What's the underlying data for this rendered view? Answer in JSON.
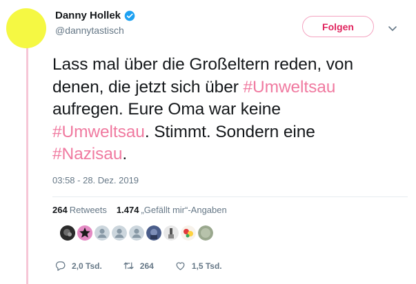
{
  "author": {
    "name": "Danny Hollek",
    "handle": "@dannytastisch"
  },
  "follow_label": "Folgen",
  "tweet": {
    "lines": [
      [
        {
          "t": "Lass mal über die Großeltern reden, von",
          "h": false
        }
      ],
      [
        {
          "t": "denen, die jetzt sich über ",
          "h": false
        },
        {
          "t": "#Umweltsau",
          "h": true
        }
      ],
      [
        {
          "t": "aufregen. Eure Oma war keine",
          "h": false
        }
      ],
      [
        {
          "t": "#Umweltsau",
          "h": true
        },
        {
          "t": ". Stimmt. Sondern eine",
          "h": false
        }
      ],
      [
        {
          "t": "#Nazisau",
          "h": true
        },
        {
          "t": ".",
          "h": false
        }
      ]
    ]
  },
  "timestamp": "03:58 - 28. Dez. 2019",
  "stats": {
    "retweets_count": "264",
    "retweets_label": "Retweets",
    "likes_count": "1.474",
    "likes_label": "„Gefällt mir“-Angaben"
  },
  "actions": {
    "replies": "2,0 Tsd.",
    "retweets": "264",
    "likes": "1,5 Tsd."
  },
  "colors": {
    "accent": "#e0245e",
    "hashtag": "#f07aa0",
    "avatar": "#f5f843",
    "thread_line": "#f6c6d6",
    "verified": "#1da1f2"
  },
  "icons": {
    "verified": "verified-badge-icon",
    "caret": "chevron-down-icon",
    "reply": "reply-icon",
    "retweet": "retweet-icon",
    "like": "heart-icon"
  }
}
